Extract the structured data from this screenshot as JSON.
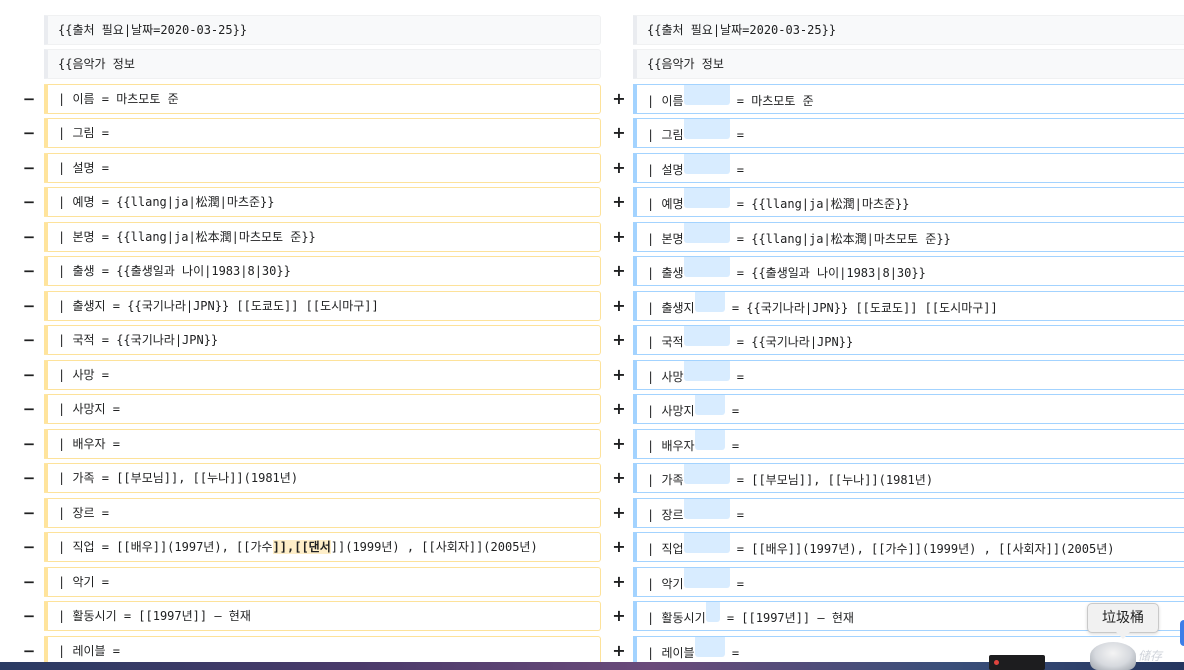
{
  "diff": {
    "context_rows": [
      {
        "left": "{{출처 필요|날짜=2020-03-25}}",
        "right": "{{출처 필요|날짜=2020-03-25}}"
      },
      {
        "left": "{{음악가 정보",
        "right": "{{음악가 정보"
      }
    ],
    "changed_rows": [
      {
        "del_marker": "−",
        "add_marker": "+",
        "left": "| 이름 = 마츠모토 준",
        "right_key": "| 이름",
        "right_value": "= 마츠모토 준"
      },
      {
        "del_marker": "−",
        "add_marker": "+",
        "left": "| 그림 =",
        "right_key": "| 그림",
        "right_value": "="
      },
      {
        "del_marker": "−",
        "add_marker": "+",
        "left": "| 설명 =",
        "right_key": "| 설명",
        "right_value": "="
      },
      {
        "del_marker": "−",
        "add_marker": "+",
        "left": "| 예명 = {{llang|ja|松潤|마츠준}}",
        "right_key": "| 예명",
        "right_value": "= {{llang|ja|松潤|마츠준}}"
      },
      {
        "del_marker": "−",
        "add_marker": "+",
        "left": "| 본명 = {{llang|ja|松本潤|마츠모토 준}}",
        "right_key": "| 본명",
        "right_value": "= {{llang|ja|松本潤|마츠모토 준}}"
      },
      {
        "del_marker": "−",
        "add_marker": "+",
        "left": "| 출생 = {{출생일과 나이|1983|8|30}}",
        "right_key": "| 출생",
        "right_value": "= {{출생일과 나이|1983|8|30}}"
      },
      {
        "del_marker": "−",
        "add_marker": "+",
        "left": "| 출생지 = {{국기나라|JPN}} [[도쿄도]] [[도시마구]]",
        "right_key": "| 출생지",
        "right_value": "= {{국기나라|JPN}} [[도쿄도]] [[도시마구]]"
      },
      {
        "del_marker": "−",
        "add_marker": "+",
        "left": "| 국적 = {{국기나라|JPN}}",
        "right_key": "| 국적",
        "right_value": "= {{국기나라|JPN}}"
      },
      {
        "del_marker": "−",
        "add_marker": "+",
        "left": "| 사망 =",
        "right_key": "| 사망",
        "right_value": "="
      },
      {
        "del_marker": "−",
        "add_marker": "+",
        "left": "| 사망지 =",
        "right_key": "| 사망지",
        "right_value": "="
      },
      {
        "del_marker": "−",
        "add_marker": "+",
        "left": "| 배우자 =",
        "right_key": "| 배우자",
        "right_value": "="
      },
      {
        "del_marker": "−",
        "add_marker": "+",
        "left": "| 가족 = [[부모님]], [[누나]](1981년)",
        "right_key": "| 가족",
        "right_value": "= [[부모님]], [[누나]](1981년)"
      },
      {
        "del_marker": "−",
        "add_marker": "+",
        "left": "| 장르 =",
        "right_key": "| 장르",
        "right_value": "="
      },
      {
        "del_marker": "−",
        "add_marker": "+",
        "left_pre": "| 직업 = [[배우]](1997년), [[가수",
        "left_removed": "]],[[댄서",
        "left_post": "]](1999년) , [[사회자]](2005년)",
        "right_key": "| 직업",
        "right_value": "= [[배우]](1997년), [[가수]](1999년) , [[사회자]](2005년)"
      },
      {
        "del_marker": "−",
        "add_marker": "+",
        "left": "| 악기 =",
        "right_key": "| 악기",
        "right_value": "="
      },
      {
        "del_marker": "−",
        "add_marker": "+",
        "left": "| 활동시기 = [[1997년]] – 현재",
        "right_key": "| 활동시기",
        "right_value": "= [[1997년]] – 현재"
      },
      {
        "del_marker": "−",
        "add_marker": "+",
        "left": "| 레이블 =",
        "right_key": "| 레이블",
        "right_value": "="
      }
    ]
  },
  "tooltip": {
    "label": "垃圾桶"
  },
  "dock": {
    "trash_caption": "储存"
  },
  "colors": {
    "deleted_border": "#ffe49c",
    "added_border": "#a3d3ff",
    "added_highlight": "#d8ecff",
    "removed_highlight": "#feeec8"
  }
}
